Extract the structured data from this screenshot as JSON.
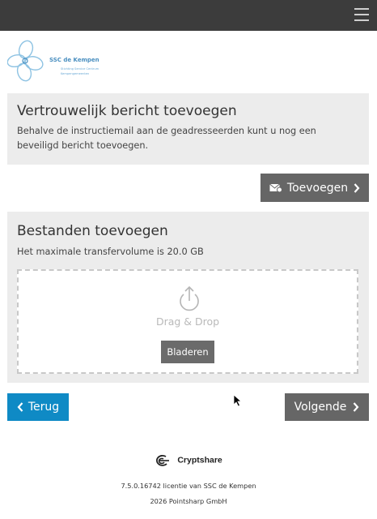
{
  "header": {
    "menu_icon": "hamburger-menu-icon",
    "background": "#3c3c3c"
  },
  "logo": {
    "name": "SSC de Kempen",
    "line1": "Stichting Service Centrum",
    "line2": "Kempengemeenten"
  },
  "message_section": {
    "title": "Vertrouwelijk bericht toevoegen",
    "description": "Behalve de instructiemail aan de geadresseerden kunt u nog een beveiligd bericht toevoegen.",
    "add_button": {
      "label": "Toevoegen",
      "icon": "envelope-lock-icon"
    }
  },
  "files_section": {
    "title": "Bestanden toevoegen",
    "limit_text": "Het maximale transfervolume is 20.0 GB",
    "dropzone": {
      "icon": "upload-icon",
      "text": "Drag & Drop",
      "browse_label": "Bladeren"
    }
  },
  "navigation": {
    "back_label": "Terug",
    "next_label": "Volgende"
  },
  "footer": {
    "brand": "Cryptshare",
    "license": "7.5.0.16742 licentie van SSC de Kempen",
    "copyright": "2026 Pointsharp GmbH"
  },
  "colors": {
    "accent_blue": "#0f8ac5",
    "button_grey": "#666666",
    "panel_bg": "#ececec"
  }
}
